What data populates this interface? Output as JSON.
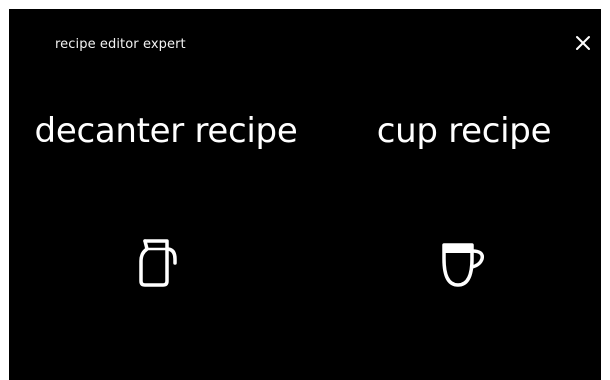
{
  "header": {
    "title": "recipe editor expert"
  },
  "options": [
    {
      "label": "decanter recipe",
      "icon": "decanter-icon"
    },
    {
      "label": "cup recipe",
      "icon": "cup-icon"
    }
  ],
  "colors": {
    "background": "#000000",
    "text": "#ffffff"
  }
}
